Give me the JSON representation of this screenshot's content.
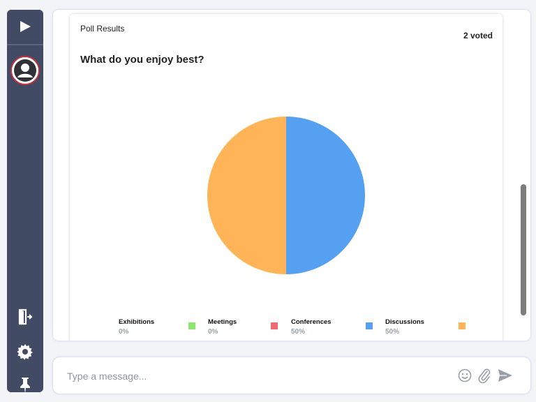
{
  "sidebar": {
    "icons": [
      "play-icon",
      "user-avatar-icon",
      "exit-door-icon",
      "gear-icon",
      "pin-icon"
    ],
    "avatar_border_color": "#c5303a",
    "background": "#424b64"
  },
  "poll": {
    "header": "Poll Results",
    "voted": "2 voted",
    "question": "What do you enjoy best?",
    "options": [
      {
        "label": "Exhibitions",
        "percent": "0%",
        "color": "#8ee66e"
      },
      {
        "label": "Meetings",
        "percent": "0%",
        "color": "#ef6b73"
      },
      {
        "label": "Conferences",
        "percent": "50%",
        "color": "#56a0f2"
      },
      {
        "label": "Discussions",
        "percent": "50%",
        "color": "#ffb557"
      }
    ]
  },
  "chart_data": {
    "type": "pie",
    "categories": [
      "Exhibitions",
      "Meetings",
      "Conferences",
      "Discussions"
    ],
    "values": [
      0,
      0,
      50,
      50
    ],
    "colors": [
      "#8ee66e",
      "#ef6b73",
      "#56a0f2",
      "#ffb557"
    ]
  },
  "message_input": {
    "placeholder": "Type a message..."
  }
}
